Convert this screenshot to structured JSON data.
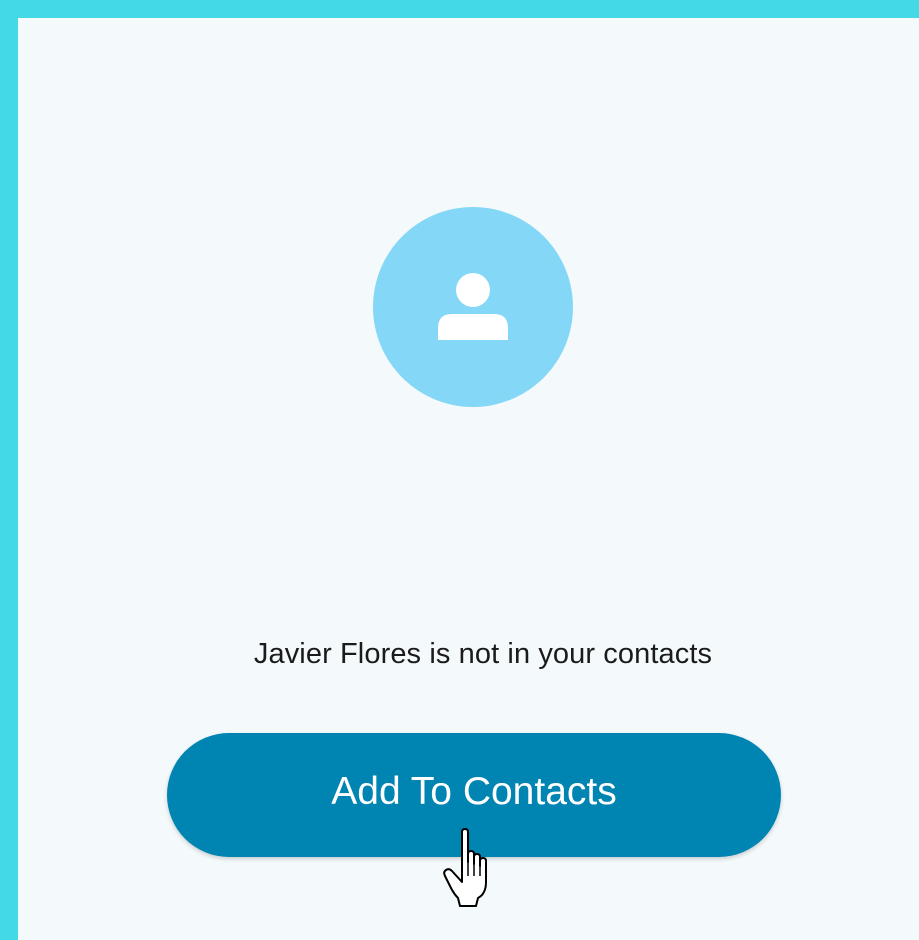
{
  "colors": {
    "frame_border": "#44D9E6",
    "panel_background": "#F4FAFC",
    "avatar_background": "#84D7F6",
    "button_background": "#0085B3",
    "button_text": "#FFFFFF",
    "message_text": "#1B1B1B"
  },
  "contact": {
    "name": "Javier Flores",
    "avatar_icon": "person-icon"
  },
  "message": {
    "suffix": " is not in your contacts"
  },
  "actions": {
    "add_to_contacts_label": "Add To Contacts"
  },
  "cursor": {
    "icon": "hand-pointer-icon"
  }
}
